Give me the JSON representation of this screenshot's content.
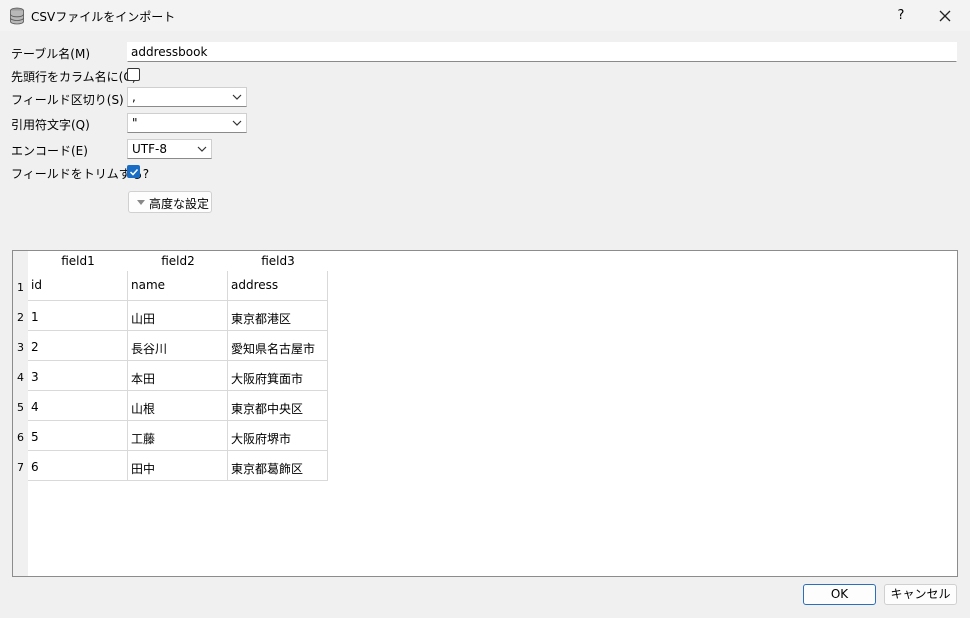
{
  "window": {
    "title": "CSVファイルをインポート",
    "help_label": "?",
    "icons": {
      "app": "database-icon",
      "close": "close-icon"
    }
  },
  "form": {
    "table_name": {
      "label": "テーブル名(M)",
      "value": "addressbook"
    },
    "header_as_columns": {
      "label": "先頭行をカラム名に(C)",
      "checked": false
    },
    "field_separator": {
      "label": "フィールド区切り(S)",
      "value": ","
    },
    "quote_char": {
      "label": "引用符文字(Q)",
      "value": "\""
    },
    "encoding": {
      "label": "エンコード(E)",
      "value": "UTF-8"
    },
    "trim_fields": {
      "label": "フィールドをトリムする?",
      "checked": true
    },
    "advanced_label": "高度な設定"
  },
  "preview": {
    "columns": [
      "field1",
      "field2",
      "field3"
    ],
    "rows": [
      {
        "num": "1",
        "cells": [
          "id",
          "name",
          "address"
        ]
      },
      {
        "num": "2",
        "cells": [
          "1",
          "山田",
          "東京都港区"
        ]
      },
      {
        "num": "3",
        "cells": [
          "2",
          "長谷川",
          "愛知県名古屋市"
        ]
      },
      {
        "num": "4",
        "cells": [
          "3",
          "本田",
          "大阪府箕面市"
        ]
      },
      {
        "num": "5",
        "cells": [
          "4",
          "山根",
          "東京都中央区"
        ]
      },
      {
        "num": "6",
        "cells": [
          "5",
          "工藤",
          "大阪府堺市"
        ]
      },
      {
        "num": "7",
        "cells": [
          "6",
          "田中",
          "東京都葛飾区"
        ]
      }
    ]
  },
  "buttons": {
    "ok": "OK",
    "cancel": "キャンセル"
  },
  "colors": {
    "accent": "#1a6dc4",
    "background": "#f0f0f0"
  }
}
